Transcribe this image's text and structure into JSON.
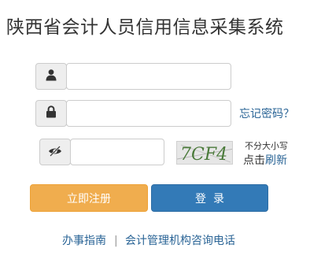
{
  "title": "陕西省会计人员信用信息采集系统",
  "username": {
    "value": "",
    "placeholder": ""
  },
  "password": {
    "value": "",
    "placeholder": ""
  },
  "forgot_password": "忘记密码？",
  "captcha": {
    "input_value": "",
    "image_text": "7CF4",
    "case_hint": "不分大小写",
    "refresh_prefix": "点击",
    "refresh_link": "刷新"
  },
  "buttons": {
    "register": "立即注册",
    "login": "登  录"
  },
  "footer": {
    "guide": "办事指南",
    "separator": "|",
    "contact": "会计管理机构咨询电话"
  },
  "colors": {
    "register_button": "#f0ad4e",
    "login_button": "#337ab7",
    "link": "#2a6496"
  }
}
